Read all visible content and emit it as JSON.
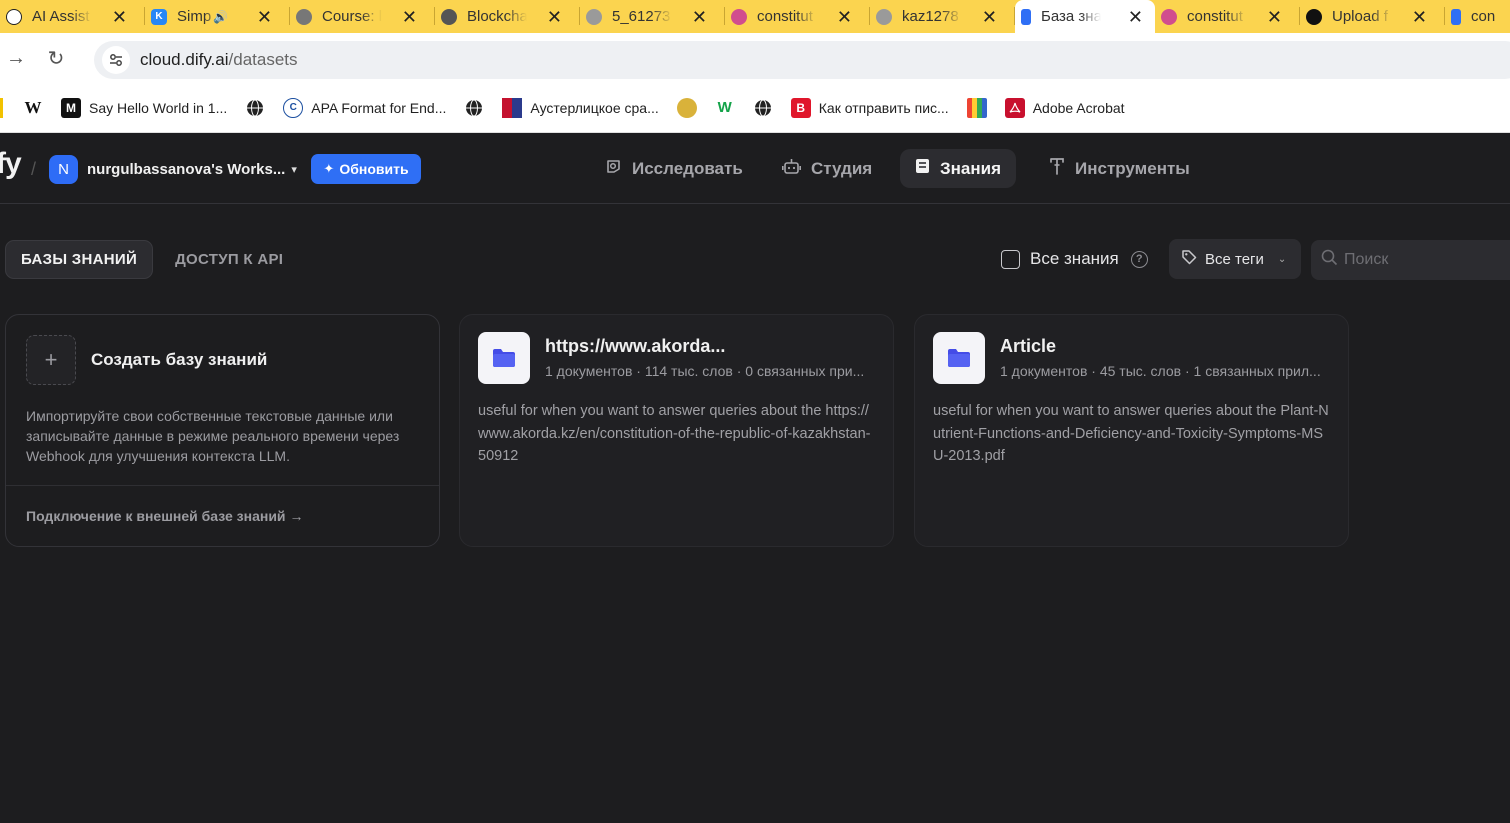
{
  "browser": {
    "tabs": [
      {
        "title": "AI Assist",
        "icon": "openai-icon",
        "color": "#222222",
        "active": false
      },
      {
        "title": "Simp",
        "icon": "vk-icon",
        "color": "#2787f5",
        "active": false,
        "audio": true
      },
      {
        "title": "Course: l",
        "icon": "course-icon",
        "color": "#4a4a4a",
        "active": false
      },
      {
        "title": "Blockcha",
        "icon": "blockchain-icon",
        "color": "#555555",
        "active": false
      },
      {
        "title": "5_61273",
        "icon": "globe-icon",
        "color": "#8a8a8a",
        "active": false
      },
      {
        "title": "constitut",
        "icon": "dify-face-icon",
        "color": "#d14d8e",
        "active": false
      },
      {
        "title": "kaz1278",
        "icon": "globe-icon",
        "color": "#8a8a8a",
        "active": false
      },
      {
        "title": "База зна",
        "icon": "dify-icon",
        "color": "#2f6ff5",
        "active": true
      },
      {
        "title": "constitut",
        "icon": "dify-face-icon",
        "color": "#d14d8e",
        "active": false
      },
      {
        "title": "Upload f",
        "icon": "github-icon",
        "color": "#111111",
        "active": false
      },
      {
        "title": "con",
        "icon": "dify-icon",
        "color": "#2f6ff5",
        "active": false
      }
    ],
    "url_host": "cloud.dify.ai",
    "url_path": "/datasets",
    "bookmarks": [
      {
        "label": "",
        "icon": "wikipedia-icon",
        "glyph": "W"
      },
      {
        "label": "Say Hello World in 1...",
        "icon": "medium-icon",
        "glyph": "M"
      },
      {
        "label": "",
        "icon": "globe-icon",
        "glyph": ""
      },
      {
        "label": "APA Format for End...",
        "icon": "citation-icon",
        "glyph": "C"
      },
      {
        "label": "",
        "icon": "globe-icon",
        "glyph": ""
      },
      {
        "label": "Аустерлицкое сра...",
        "icon": "flag-icon",
        "glyph": ""
      },
      {
        "label": "",
        "icon": "emblem-icon",
        "glyph": ""
      },
      {
        "label": "",
        "icon": "w3-icon",
        "glyph": "W"
      },
      {
        "label": "",
        "icon": "globe-icon",
        "glyph": ""
      },
      {
        "label": "Как отправить пис...",
        "icon": "b-icon",
        "glyph": "B"
      },
      {
        "label": "",
        "icon": "book-icon",
        "glyph": ""
      },
      {
        "label": "Adobe Acrobat",
        "icon": "acrobat-icon",
        "glyph": ""
      }
    ]
  },
  "app": {
    "logo_text": "fy",
    "workspace": {
      "initial": "N",
      "name": "nurgulbassanova's Works..."
    },
    "upgrade_label": "Обновить",
    "nav": [
      {
        "label": "Исследовать",
        "icon": "explore-icon"
      },
      {
        "label": "Студия",
        "icon": "robot-icon"
      },
      {
        "label": "Знания",
        "icon": "book-icon"
      },
      {
        "label": "Инструменты",
        "icon": "tools-icon"
      }
    ],
    "active_nav": "Знания"
  },
  "page": {
    "tabs": [
      {
        "label": "БАЗЫ ЗНАНИЙ",
        "active": true
      },
      {
        "label": "ДОСТУП К API",
        "active": false
      }
    ],
    "all_knowledge_label": "Все знания",
    "tags_label": "Все теги",
    "search_placeholder": "Поиск",
    "create_card": {
      "title": "Создать базу знаний",
      "description": "Импортируйте свои собственные текстовые данные или записывайте данные в режиме реального времени через Webhook для улучшения контекста LLM.",
      "external_link": "Подключение к внешней базе знаний"
    },
    "datasets": [
      {
        "title": "https://www.akorda...",
        "meta": "1 документов · 114 тыс. слов · 0 связанных при...",
        "description": "useful for when you want to answer queries about the https://www.akorda.kz/en/constitution-of-the-republic-of-kazakhstan-50912"
      },
      {
        "title": "Article",
        "meta": "1 документов · 45 тыс. слов · 1 связанных прил...",
        "description": "useful for when you want to answer queries about the Plant-Nutrient-Functions-and-Deficiency-and-Toxicity-Symptoms-MSU-2013.pdf"
      }
    ]
  }
}
